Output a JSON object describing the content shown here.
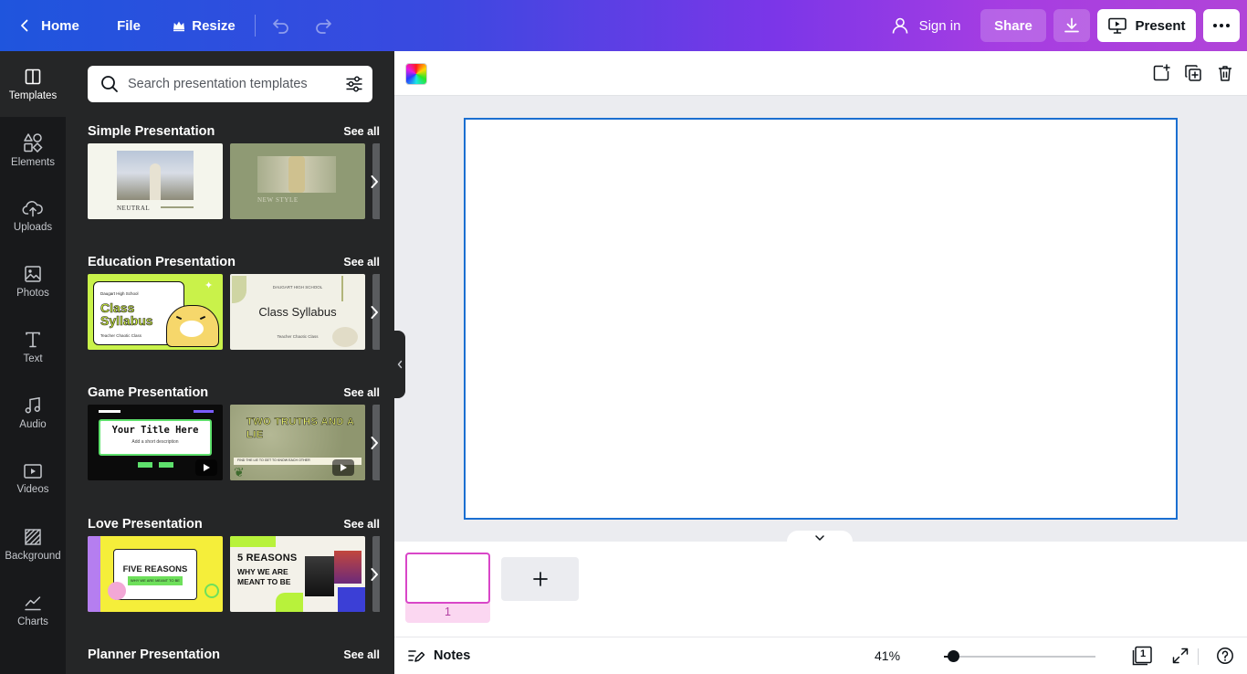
{
  "topbar": {
    "home_label": "Home",
    "file_label": "File",
    "resize_label": "Resize",
    "signin_label": "Sign in",
    "share_label": "Share",
    "present_label": "Present"
  },
  "rail": {
    "items": [
      {
        "label": "Templates",
        "icon": "templates-icon"
      },
      {
        "label": "Elements",
        "icon": "elements-icon"
      },
      {
        "label": "Uploads",
        "icon": "uploads-icon"
      },
      {
        "label": "Photos",
        "icon": "photos-icon"
      },
      {
        "label": "Text",
        "icon": "text-icon"
      },
      {
        "label": "Audio",
        "icon": "audio-icon"
      },
      {
        "label": "Videos",
        "icon": "videos-icon"
      },
      {
        "label": "Background",
        "icon": "background-icon"
      },
      {
        "label": "Charts",
        "icon": "charts-icon"
      }
    ]
  },
  "search": {
    "placeholder": "Search presentation templates",
    "value": ""
  },
  "sections": [
    {
      "title": "Simple Presentation",
      "see_all": "See all",
      "thumbs": [
        {
          "caption": "NEUTRAL"
        },
        {
          "caption": "NEW STYLE"
        }
      ]
    },
    {
      "title": "Education Presentation",
      "see_all": "See all",
      "thumbs": [
        {
          "caption": "Class Syllabus",
          "small": "Daugart High School",
          "sub": "Teacher Chaotic Class"
        },
        {
          "caption": "Class Syllabus",
          "small": "DAUGART HIGH SCHOOL",
          "sub": "Teacher Chaotic Class"
        }
      ]
    },
    {
      "title": "Game Presentation",
      "see_all": "See all",
      "thumbs": [
        {
          "caption": "Your Title Here",
          "sub": "Add a short description"
        },
        {
          "caption": "TWO TRUTHS AND A LIE",
          "sub": "FIND THE LIE TO GET TO KNOW EACH OTHER"
        }
      ]
    },
    {
      "title": "Love Presentation",
      "see_all": "See all",
      "thumbs": [
        {
          "caption": "FIVE REASONS",
          "sub": "WHY WE ARE MEANT TO BE"
        },
        {
          "caption": "5 REASONS",
          "sub": "WHY WE ARE MEANT TO BE"
        }
      ]
    },
    {
      "title": "Planner Presentation",
      "see_all": "See all",
      "thumbs": []
    }
  ],
  "pages": {
    "current_page_number": "1"
  },
  "footer": {
    "notes_label": "Notes",
    "zoom_value": "41%",
    "zoom_fraction": 0.06,
    "page_count": "1"
  },
  "colors": {
    "accent_blue": "#1b6fd1",
    "page_pink": "#d946c8",
    "rail_bg": "#18191b",
    "panel_bg": "#252627"
  }
}
